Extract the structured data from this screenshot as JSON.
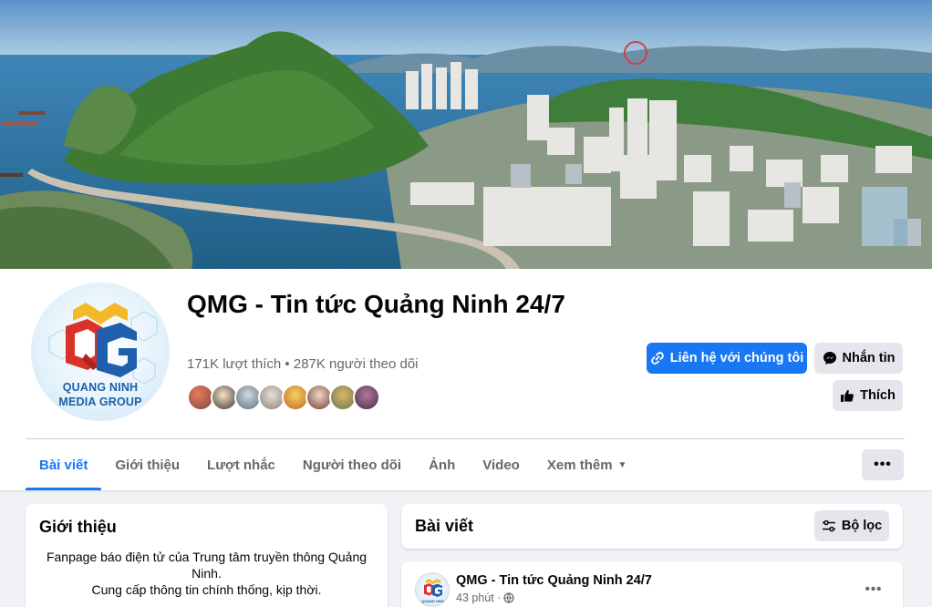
{
  "cover": {
    "alt": ""
  },
  "logo": {
    "line1": "QUANG NINH",
    "line2": "MEDIA GROUP"
  },
  "page": {
    "title": "QMG - Tin tức Quảng Ninh 24/7",
    "stats": "171K lượt thích • 287K người theo dõi"
  },
  "actions": {
    "contact_label": "Liên hệ với chúng tôi",
    "message_label": "Nhắn tin",
    "like_label": "Thích"
  },
  "tabs": [
    {
      "label": "Bài viết"
    },
    {
      "label": "Giới thiệu"
    },
    {
      "label": "Lượt nhắc"
    },
    {
      "label": "Người theo dõi"
    },
    {
      "label": "Ảnh"
    },
    {
      "label": "Video"
    },
    {
      "label": "Xem thêm"
    }
  ],
  "more_dots": "•••",
  "intro": {
    "title": "Giới thiệu",
    "line1": "Fanpage báo điện tử của Trung tâm truyền thông Quảng Ninh.",
    "line2": "Cung cấp thông tin chính thống, kịp thời."
  },
  "posts": {
    "title": "Bài viết",
    "filter_label": "Bộ lọc"
  },
  "post": {
    "author": "QMG - Tin tức Quảng Ninh 24/7",
    "time": "43 phút ·",
    "menu": "•••"
  },
  "colors": {
    "accent": "#1877f2",
    "secondary_button": "#e4e6eb",
    "background": "#f0f2f5"
  },
  "icons": [
    "link-icon",
    "messenger-icon",
    "thumbs-up-icon",
    "chevron-down-icon",
    "more-icon",
    "filter-icon",
    "globe-icon"
  ]
}
